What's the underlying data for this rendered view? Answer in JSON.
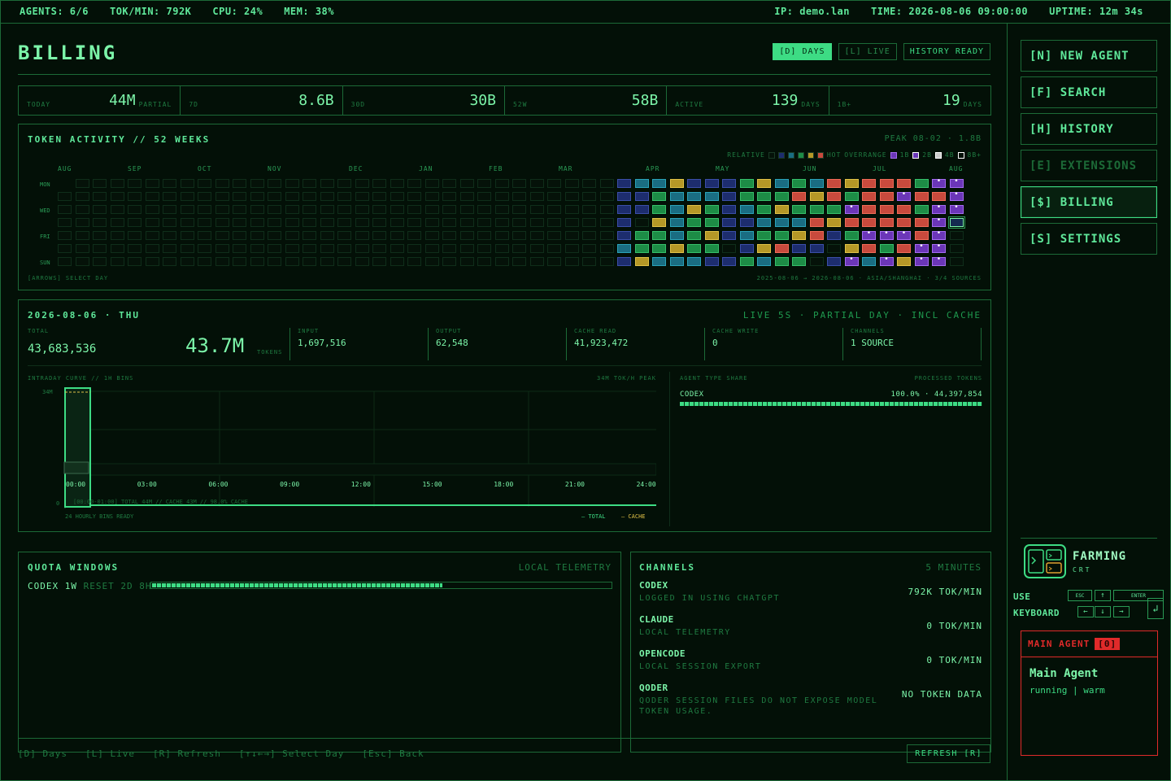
{
  "topbar": {
    "agents": "AGENTS: 6/6",
    "tokmin": "TOK/MIN: 792K",
    "cpu": "CPU: 24%",
    "mem": "MEM: 38%",
    "ip": "IP: demo.lan",
    "time": "TIME: 2026-08-06 09:00:00",
    "uptime": "UPTIME: 12m 34s"
  },
  "page": {
    "title": "BILLING",
    "mode_days": "[D] DAYS",
    "mode_live": "[L] LIVE",
    "history_status": "HISTORY READY"
  },
  "stats": [
    {
      "label": "TODAY",
      "value": "44M",
      "unit": "PARTIAL"
    },
    {
      "label": "7D",
      "value": "8.6B",
      "unit": ""
    },
    {
      "label": "30D",
      "value": "30B",
      "unit": ""
    },
    {
      "label": "52W",
      "value": "58B",
      "unit": ""
    },
    {
      "label": "ACTIVE",
      "value": "139",
      "unit": "DAYS"
    },
    {
      "label": "1B+",
      "value": "19",
      "unit": "DAYS"
    }
  ],
  "heatmap": {
    "title": "TOKEN ACTIVITY // 52 WEEKS",
    "peak": "PEAK 08-02 · 1.8B",
    "legend_relative": "RELATIVE",
    "legend_hot": "HOT",
    "legend_overrange": "OVERRANGE",
    "legend_1b": "1B",
    "legend_2b": "2B",
    "legend_4b": "4B",
    "legend_8b": "8B+",
    "months": [
      "AUG",
      "SEP",
      "OCT",
      "NOV",
      "DEC",
      "JAN",
      "FEB",
      "MAR",
      "APR",
      "MAY",
      "JUN",
      "JUL",
      "AUG"
    ],
    "days": [
      "MON",
      "WED",
      "FRI",
      "SUN"
    ],
    "footer_left": "[ARROWS] SELECT DAY",
    "footer_right": "2025-08-06 → 2026-08-06 · ASIA/SHANGHAI · 3/4 SOURCES",
    "colors": {
      "blue": "#1d2d6e",
      "teal": "#1a6d82",
      "green": "#1d8c46",
      "gold": "#b59827",
      "red": "#c84a3d",
      "purple": "#6b36b8"
    },
    "weeks": [
      "......."
    ]
  },
  "detail": {
    "date": "2026-08-06 · THU",
    "status": "LIVE 5S · PARTIAL DAY · INCL CACHE",
    "total_label": "TOTAL",
    "total_value": "43,683,536",
    "total_big": "43.7M",
    "tokens_label": "TOKENS",
    "metrics": [
      {
        "label": "INPUT",
        "value": "1,697,516"
      },
      {
        "label": "OUTPUT",
        "value": "62,548"
      },
      {
        "label": "CACHE READ",
        "value": "41,923,472"
      },
      {
        "label": "CACHE WRITE",
        "value": "0"
      },
      {
        "label": "CHANNELS",
        "value": "1 SOURCE"
      }
    ],
    "curve_title": "INTRADAY CURVE // 1H BINS",
    "curve_peak": "34M TOK/H PEAK",
    "curve_ymax": "34M",
    "curve_ymin": "0",
    "curve_xticks": [
      "00:00",
      "03:00",
      "06:00",
      "09:00",
      "12:00",
      "15:00",
      "18:00",
      "21:00",
      "24:00"
    ],
    "curve_tooltip": "[00:00-01:00] TOTAL 44M // CACHE 43M // 98.0% CACHE",
    "curve_footer": "24 HOURLY BINS READY",
    "curve_legend_total": "— TOTAL",
    "curve_legend_cache": "— CACHE",
    "share_title": "AGENT TYPE SHARE",
    "share_right": "PROCESSED TOKENS",
    "share_name": "CODEX",
    "share_value": "100.0% · 44,397,854",
    "share_fraction": 1.0
  },
  "quota": {
    "title": "QUOTA WINDOWS",
    "right": "LOCAL TELEMETRY",
    "row_name": "CODEX 1W",
    "row_reset": "RESET 2D 8H",
    "fraction": 0.63
  },
  "channels": {
    "title": "CHANNELS",
    "right": "5 MINUTES",
    "items": [
      {
        "name": "CODEX",
        "sub": "LOGGED IN USING CHATGPT",
        "rate": "792K TOK/MIN"
      },
      {
        "name": "CLAUDE",
        "sub": "LOCAL TELEMETRY",
        "rate": "0 TOK/MIN"
      },
      {
        "name": "OPENCODE",
        "sub": "LOCAL SESSION EXPORT",
        "rate": "0 TOK/MIN"
      },
      {
        "name": "QODER",
        "sub": "QODER SESSION FILES DO NOT EXPOSE MODEL TOKEN USAGE.",
        "rate": "NO TOKEN DATA"
      }
    ]
  },
  "footer": {
    "keys": [
      "[D] Days",
      "[L] Live",
      "[R] Refresh",
      "[↑↓←→] Select Day",
      "[Esc] Back"
    ],
    "refresh": "REFRESH [R]"
  },
  "sidebar": {
    "items": [
      {
        "label": "[N] NEW AGENT",
        "state": "normal"
      },
      {
        "label": "[F] SEARCH",
        "state": "normal"
      },
      {
        "label": "[H] HISTORY",
        "state": "normal"
      },
      {
        "label": "[E] EXTENSIONS",
        "state": "disabled"
      },
      {
        "label": "[$] BILLING",
        "state": "active"
      },
      {
        "label": "[S] SETTINGS",
        "state": "normal"
      }
    ],
    "brand_name": "FARMING",
    "brand_sub": "CRT",
    "use_keyboard_1": "USE",
    "use_keyboard_2": "KEYBOARD",
    "key_esc": "ESC",
    "key_up": "↑",
    "key_enter": "ENTER",
    "key_left": "←",
    "key_down": "↓",
    "key_right": "→",
    "key_return": "↲",
    "agent_header": "MAIN AGENT",
    "agent_badge": "[0]",
    "agent_name": "Main Agent",
    "agent_status": "running | warm"
  }
}
